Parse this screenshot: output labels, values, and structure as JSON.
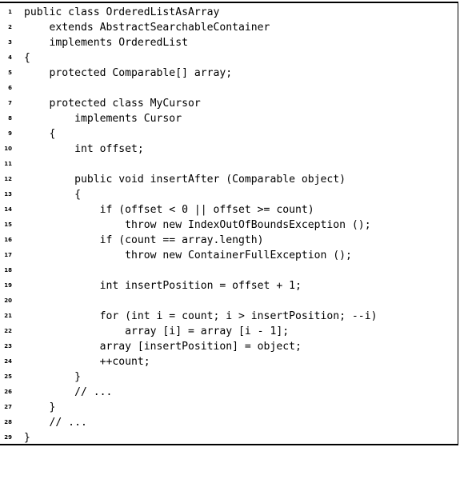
{
  "listing": {
    "lines": [
      {
        "num": "1",
        "text": "public class OrderedListAsArray"
      },
      {
        "num": "2",
        "text": "    extends AbstractSearchableContainer"
      },
      {
        "num": "3",
        "text": "    implements OrderedList"
      },
      {
        "num": "4",
        "text": "{"
      },
      {
        "num": "5",
        "text": "    protected Comparable[] array;"
      },
      {
        "num": "6",
        "text": ""
      },
      {
        "num": "7",
        "text": "    protected class MyCursor"
      },
      {
        "num": "8",
        "text": "        implements Cursor"
      },
      {
        "num": "9",
        "text": "    {"
      },
      {
        "num": "10",
        "text": "        int offset;"
      },
      {
        "num": "11",
        "text": ""
      },
      {
        "num": "12",
        "text": "        public void insertAfter (Comparable object)"
      },
      {
        "num": "13",
        "text": "        {"
      },
      {
        "num": "14",
        "text": "            if (offset < 0 || offset >= count)"
      },
      {
        "num": "15",
        "text": "                throw new IndexOutOfBoundsException ();"
      },
      {
        "num": "16",
        "text": "            if (count == array.length)"
      },
      {
        "num": "17",
        "text": "                throw new ContainerFullException ();"
      },
      {
        "num": "18",
        "text": ""
      },
      {
        "num": "19",
        "text": "            int insertPosition = offset + 1;"
      },
      {
        "num": "20",
        "text": ""
      },
      {
        "num": "21",
        "text": "            for (int i = count; i > insertPosition; --i)"
      },
      {
        "num": "22",
        "text": "                array [i] = array [i - 1];"
      },
      {
        "num": "23",
        "text": "            array [insertPosition] = object;"
      },
      {
        "num": "24",
        "text": "            ++count;"
      },
      {
        "num": "25",
        "text": "        }"
      },
      {
        "num": "26",
        "text": "        // ..."
      },
      {
        "num": "27",
        "text": "    }"
      },
      {
        "num": "28",
        "text": "    // ..."
      },
      {
        "num": "29",
        "text": "}"
      }
    ]
  }
}
